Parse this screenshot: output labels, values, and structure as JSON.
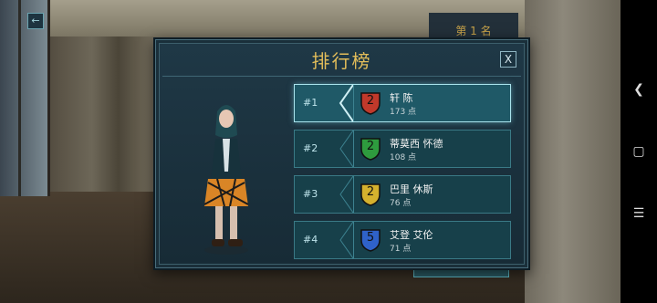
{
  "background": {
    "behind_label": "第 1 名"
  },
  "panel": {
    "title": "排行榜",
    "close_label": "X"
  },
  "leaderboard": [
    {
      "rank": "#1",
      "name": "轩 陈",
      "points": "173 点",
      "level": "2",
      "shield_color": "#c0392b",
      "active": true
    },
    {
      "rank": "#2",
      "name": "蒂莫西 怀德",
      "points": "108 点",
      "level": "2",
      "shield_color": "#2e9b3e",
      "active": false
    },
    {
      "rank": "#3",
      "name": "巴里 休斯",
      "points": "76 点",
      "level": "2",
      "shield_color": "#d4b12e",
      "active": false
    },
    {
      "rank": "#4",
      "name": "艾登 艾伦",
      "points": "71 点",
      "level": "5",
      "shield_color": "#2f62c9",
      "active": false
    }
  ],
  "nav": {
    "back_icon": "chevron-left",
    "home_icon": "rounded-square",
    "menu_icon": "hamburger"
  }
}
